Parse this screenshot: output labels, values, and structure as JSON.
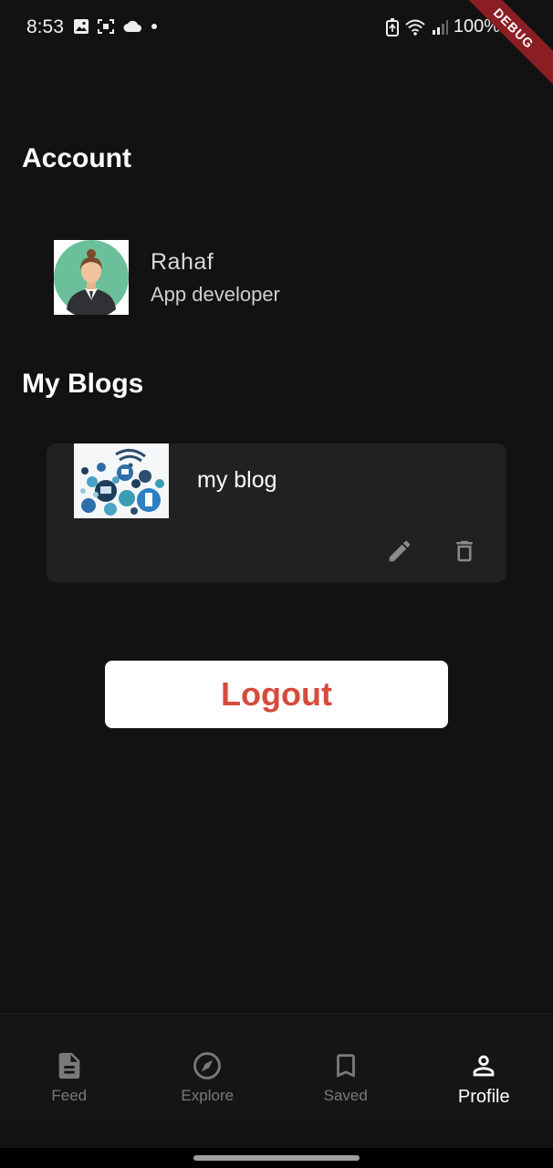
{
  "status_bar": {
    "time": "8:53",
    "battery": "100%"
  },
  "debug_banner": "DEBUG",
  "account": {
    "section_title": "Account",
    "name": "Rahaf",
    "role": "App developer"
  },
  "blogs": {
    "section_title": "My Blogs",
    "items": [
      {
        "title": "my blog"
      }
    ]
  },
  "logout_label": "Logout",
  "bottom_nav": {
    "items": [
      {
        "label": "Feed",
        "icon": "document-icon"
      },
      {
        "label": "Explore",
        "icon": "compass-icon"
      },
      {
        "label": "Saved",
        "icon": "bookmark-icon"
      },
      {
        "label": "Profile",
        "icon": "person-icon"
      }
    ],
    "active": "Profile"
  },
  "colors": {
    "background": "#121212",
    "card": "#212121",
    "logout_text": "#d64b3a",
    "nav_inactive": "#7a7a7a",
    "nav_active": "#ffffff"
  }
}
